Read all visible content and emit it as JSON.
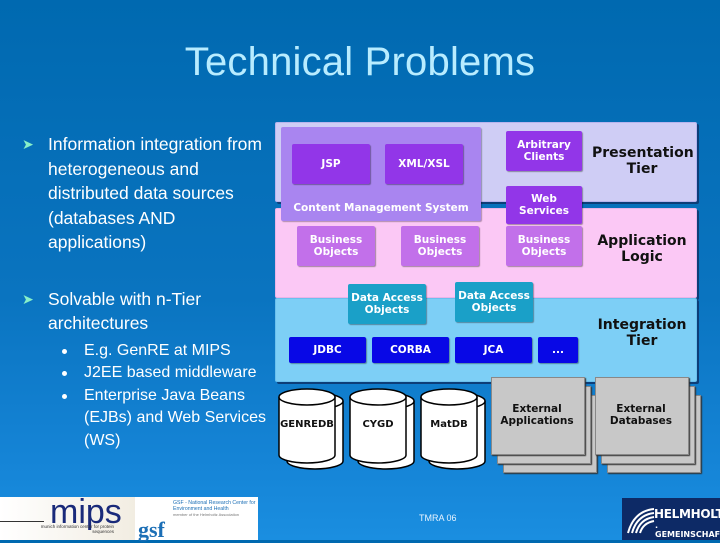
{
  "slide": {
    "title": "Technical Problems",
    "bullets": [
      {
        "text": "Information integration from heterogeneous and distributed data sources (databases AND applications)"
      },
      {
        "text": "Solvable with n-Tier architectures",
        "sub": [
          "E.g. GenRE at MIPS",
          "J2EE based middleware",
          "Enterprise Java Beans (EJBs) and Web Services (WS)"
        ]
      }
    ],
    "bullet_icon": "arrow-bullet-icon",
    "footer_text": "TMRA 06"
  },
  "diagram": {
    "tiers": {
      "presentation": "Presentation Tier",
      "application": "Application Logic",
      "integration": "Integration Tier"
    },
    "presentation": {
      "cms_label": "Content Management System",
      "jsp": "JSP",
      "xml": "XML/XSL",
      "clients": "Arbitrary Clients",
      "web_services": "Web Services"
    },
    "application": {
      "business_objects": [
        "Business Objects",
        "Business Objects",
        "Business Objects"
      ]
    },
    "integration": {
      "dao": [
        "Data Access Objects",
        "Data Access Objects"
      ],
      "connectors": [
        "JDBC",
        "CORBA",
        "JCA",
        "..."
      ]
    },
    "sources": {
      "databases": [
        "GENREDB",
        "CYGD",
        "MatDB"
      ],
      "external": [
        "External Applications",
        "External Databases"
      ]
    },
    "colors": {
      "presentation_bg": "#cfcdf5",
      "application_bg": "#fbc8f5",
      "integration_bg": "#7dcff6",
      "purple": "#9236e8",
      "violet": "#c270ea",
      "teal": "#1aa0c8",
      "blue": "#0808e6"
    }
  },
  "logos": {
    "mips": "mips",
    "mips_sub": "munich information center for protein sequences",
    "gsf": "gsf",
    "gsf_text": "GSF - National Research Center for Environment and Health",
    "gsf_sub": "member of the Helmholtz Association",
    "helmholtz_1": "HELMHOLTZ",
    "helmholtz_2": ". GEMEINSCHAFT"
  }
}
